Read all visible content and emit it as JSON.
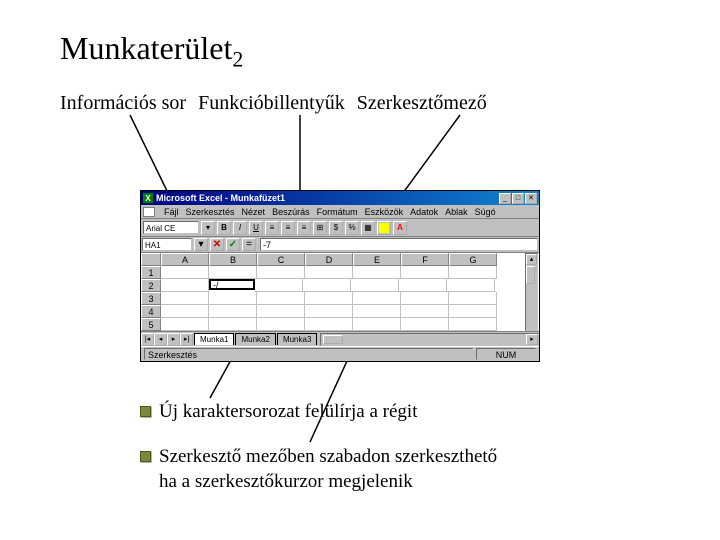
{
  "title": {
    "main": "Munkaterület",
    "sub": "2"
  },
  "labels": {
    "info_row": "Információs sor",
    "func_keys": "Funkcióbillentyűk",
    "edit_field": "Szerkesztőmező"
  },
  "excel": {
    "titlebar": {
      "app_icon": "X",
      "text": "Microsoft Excel - Munkafüzet1"
    },
    "menu": [
      "Fájl",
      "Szerkesztés",
      "Nézet",
      "Beszúrás",
      "Formátum",
      "Eszközök",
      "Adatok",
      "Ablak",
      "Súgó"
    ],
    "toolbar": {
      "font": "Arial CE",
      "buttons": {
        "bold": "B",
        "italic": "I",
        "underline": "U"
      },
      "colors": {
        "fill": "#ffff00",
        "font": "#ff0000"
      }
    },
    "formula_bar": {
      "namebox": "HA1",
      "cancel": "✕",
      "confirm": "✓",
      "equals": "=",
      "value": "-7"
    },
    "columns": [
      "A",
      "B",
      "C",
      "D",
      "E",
      "F",
      "G"
    ],
    "rows": [
      "1",
      "2",
      "3",
      "4",
      "5"
    ],
    "active_cell": {
      "row": 1,
      "col": 1,
      "value": "-/"
    },
    "sheet_tabs": {
      "nav": [
        "|◂",
        "◂",
        "▸",
        "▸|"
      ],
      "tabs": [
        "Munka1",
        "Munka2",
        "Munka3"
      ]
    },
    "statusbar": {
      "left": "Szerkesztés",
      "right": "NUM"
    },
    "window_buttons": {
      "min": "_",
      "max": "□",
      "close": "✕"
    }
  },
  "notes": {
    "line1": "Új karaktersorozat felülírja a régit",
    "line2": "Szerkesztő mezőben szabadon szerkeszthető\nha a szerkesztőkurzor megjelenik"
  }
}
